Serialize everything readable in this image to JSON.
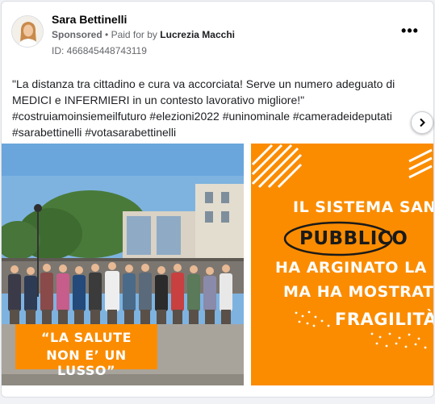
{
  "post": {
    "author": "Sara Bettinelli",
    "sponsored": "Sponsored",
    "paid_for_prefix": "Paid for by",
    "payer": "Lucrezia Macchi",
    "ad_id": "ID: 466845448743119",
    "more_icon": "more-options-icon",
    "text_lines": [
      "\"La distanza tra cittadino e cura va accorciata! Serve un numero adeguato di",
      "MEDICI e INFERMIERI in un contesto lavorativo migliore!\"",
      "#costruiamoinsiemeilfuturo #elezioni2022 #uninominale #cameradeideputati",
      "#sarabettinelli #votasarabettinelli"
    ]
  },
  "carousel": {
    "slide1": {
      "caption_lines": [
        "“LA SALUTE",
        "NON E’ UN LUSSO”"
      ]
    },
    "slide2": {
      "line1": "IL SISTEMA SANITARI",
      "line2": "PUBBLICO",
      "line3": "HA ARGINATO LA PA",
      "line4": "MA HA MOSTRATO LE S",
      "line5": "FRAGILITÀ"
    },
    "next_icon": "chevron-right-icon"
  },
  "colors": {
    "accent_orange": "#fb8c00"
  }
}
